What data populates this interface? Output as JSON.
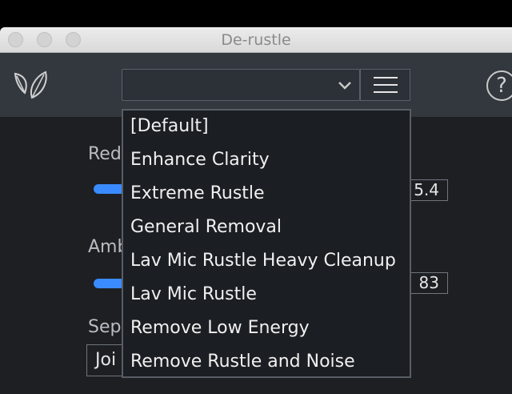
{
  "window": {
    "title": "De-rustle"
  },
  "toolbar": {
    "logo": "leaf-logo-icon",
    "preset": {
      "value": ""
    },
    "menu_icon": "hamburger-menu-icon",
    "help_label": "?"
  },
  "controls": {
    "reduction": {
      "label_partial": "Red",
      "value_partial": "5.4"
    },
    "ambience": {
      "label_partial": "Amb",
      "value_partial": "83"
    },
    "separation": {
      "label_partial": "Sep",
      "dropdown_partial": "Joi"
    }
  },
  "preset_menu": {
    "items": [
      "[Default]",
      "Enhance Clarity",
      "Extreme Rustle",
      "General Removal",
      "Lav Mic Rustle Heavy Cleanup",
      "Lav Mic Rustle",
      "Remove Low Energy",
      "Remove Rustle and Noise"
    ]
  },
  "colors": {
    "accent": "#3a8bff",
    "toolbar_bg": "#33383f",
    "panel_bg": "#1d1f23"
  }
}
